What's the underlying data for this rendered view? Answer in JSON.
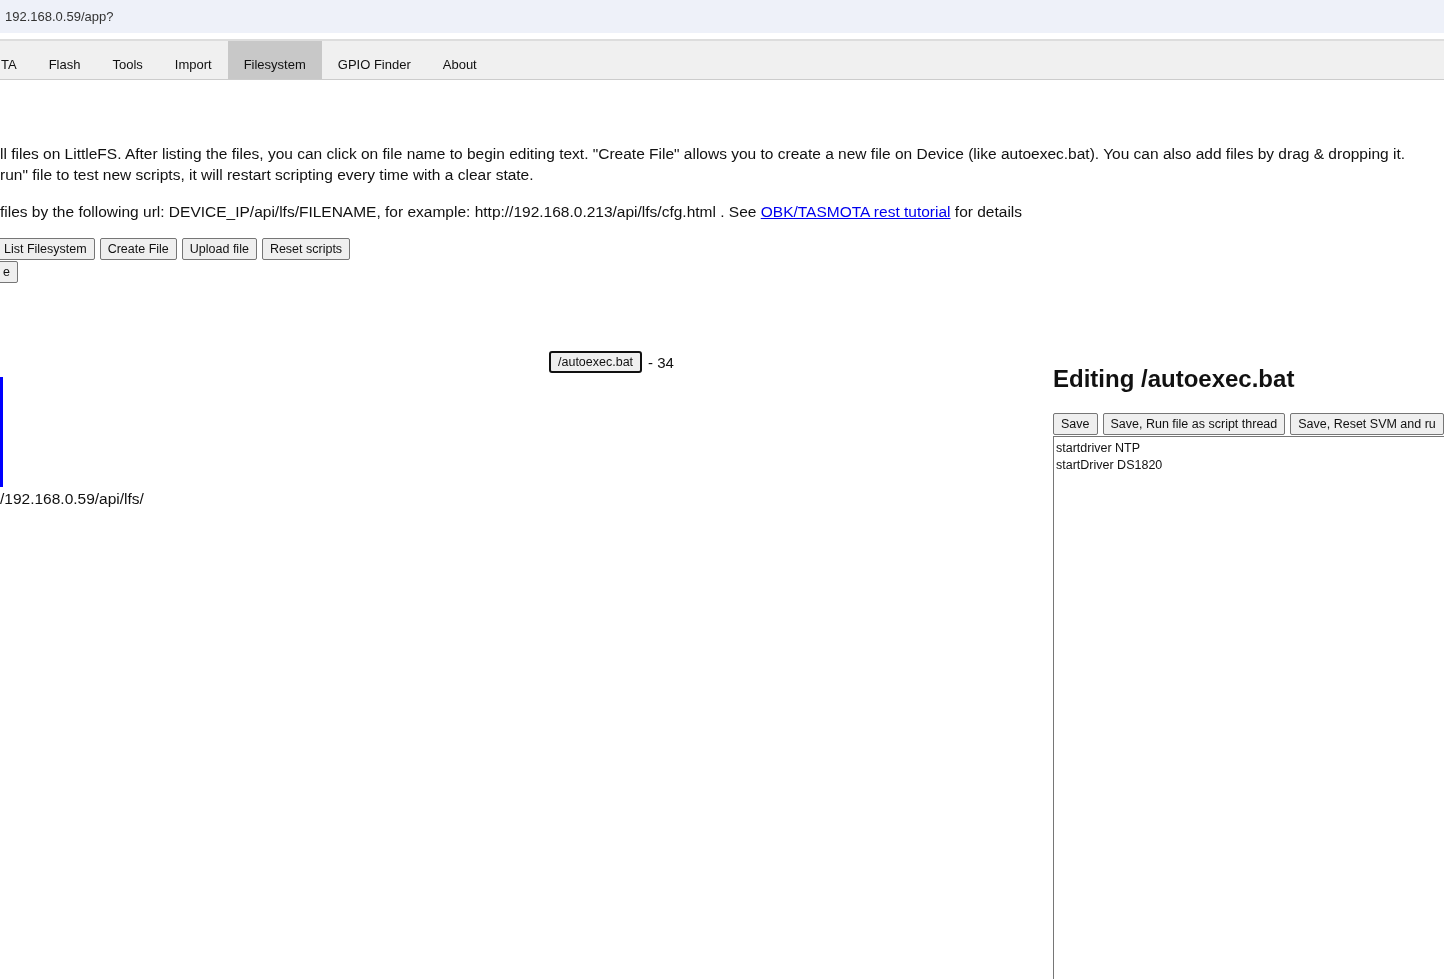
{
  "address_bar": {
    "value": "192.168.0.59/app?"
  },
  "tabs": [
    {
      "label": "TA",
      "selected": false
    },
    {
      "label": "Flash",
      "selected": false
    },
    {
      "label": "Tools",
      "selected": false
    },
    {
      "label": "Import",
      "selected": false
    },
    {
      "label": "Filesystem",
      "selected": true
    },
    {
      "label": "GPIO Finder",
      "selected": false
    },
    {
      "label": "About",
      "selected": false
    }
  ],
  "description_lines": [
    "ll files on LittleFS. After listing the files, you can click on file name to begin editing text. \"Create File\" allows you to create a new file on Device (like autoexec.bat). You can also add files by drag & dropping it.",
    "run\" file to test new scripts, it will restart scripting every time with a clear state."
  ],
  "url_note": {
    "before": "files by the following url: DEVICE_IP/api/lfs/FILENAME, for example: http://192.168.0.213/api/lfs/cfg.html . See",
    "link": "OBK/TASMOTA rest tutorial",
    "after": "for details"
  },
  "buttons": [
    "List Filesystem",
    "Create File",
    "Upload file",
    "Reset scripts"
  ],
  "second_row_buttons": [
    "e"
  ],
  "files": [
    {
      "name": "/autoexec.bat",
      "size": "- 34"
    }
  ],
  "base_url": "/192.168.0.59/api/lfs/",
  "editor": {
    "title": "Editing /autoexec.bat",
    "buttons": [
      "Save",
      "Save, Run file as script thread",
      "Save, Reset SVM and ru"
    ],
    "value": "startdriver NTP\nstartDriver DS1820"
  }
}
